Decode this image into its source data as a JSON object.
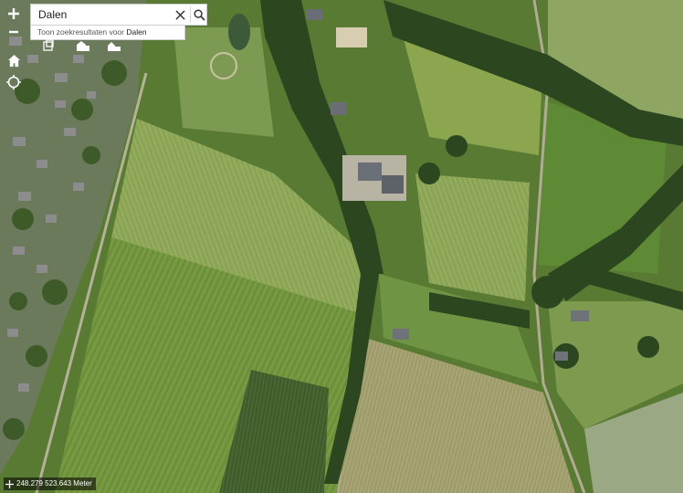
{
  "search": {
    "query": "Dalen",
    "suggestion_prefix": "Toon zoekresultaten voor",
    "suggestion_term": "Dalen"
  },
  "controls": {
    "zoom_in": "+",
    "zoom_out": "−"
  },
  "coordinates": {
    "text": "248.279 523.643 Meter"
  },
  "icons": [
    "plus-icon",
    "minus-icon",
    "home-icon",
    "locate-icon",
    "close-icon",
    "search-icon",
    "layers-icon",
    "house-icon",
    "barn-icon"
  ],
  "colors": {
    "field_light": "#86a34f",
    "field_dark": "#5f7f33",
    "trees": "#2f4a1f",
    "ui_white": "#ffffff"
  }
}
